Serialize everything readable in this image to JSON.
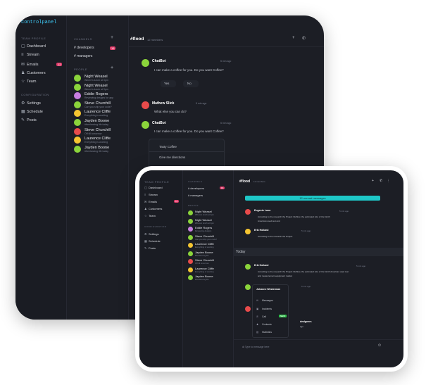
{
  "w1": {
    "logo": "controlpanel",
    "topbar": {
      "icons": [
        "◫",
        "▭"
      ]
    },
    "sidebar": {
      "section_main": "TEAM PROFILE",
      "items": [
        {
          "label": "Dashboard",
          "icon": "dashboard-icon",
          "glyph": "▢"
        },
        {
          "label": "Stream",
          "icon": "stream-icon",
          "glyph": "≡"
        },
        {
          "label": "Emails",
          "icon": "emails-icon",
          "glyph": "✉",
          "badge": "12"
        },
        {
          "label": "Customers",
          "icon": "customers-icon",
          "glyph": "♟"
        },
        {
          "label": "Team",
          "icon": "team-icon",
          "glyph": "☆"
        }
      ],
      "section_config": "CONFIGURATION",
      "config_items": [
        {
          "label": "Settings",
          "icon": "settings-icon",
          "glyph": "⚙"
        },
        {
          "label": "Schedule",
          "icon": "schedule-icon",
          "glyph": "▦"
        },
        {
          "label": "Posts",
          "icon": "posts-icon",
          "glyph": "✎"
        }
      ]
    },
    "channels": {
      "section": "CHANNELS",
      "items": [
        {
          "label": "# developers",
          "badge": "16"
        },
        {
          "label": "# managers"
        }
      ],
      "people_section": "PEOPLE",
      "people": [
        {
          "name": "Night Weasel",
          "status": "Where's lunch at 3pm",
          "color": "g"
        },
        {
          "name": "Night Weasel",
          "status": "Where's lunch at 3pm",
          "color": "g"
        },
        {
          "name": "Eddie Rogers",
          "status": "Reviewing designs for app",
          "color": "p"
        },
        {
          "name": "Steve Churchill",
          "status": "Can you ship your code?",
          "color": "g"
        },
        {
          "name": "Laurence Cliffe",
          "status": "Everything is working",
          "color": "y"
        },
        {
          "name": "Jayden Boone",
          "status": "#freelancing life today",
          "color": "g"
        },
        {
          "name": "Steve Churchill",
          "status": "Off till tomorrow",
          "color": "r"
        },
        {
          "name": "Laurence Cliffe",
          "status": "Everything is working",
          "color": "y"
        },
        {
          "name": "Jayden Boone",
          "status": "#freelancing life today",
          "color": "g"
        }
      ]
    },
    "chat": {
      "channel": "#flood",
      "members": "12 members",
      "messages": [
        {
          "name": "ChatBot",
          "time": "5 min ago",
          "text": "I can make a coffee for you. Do you want Coffee?"
        },
        {
          "name": "Mathew Slick",
          "time": "5 min ago",
          "text": "What else you can do?"
        },
        {
          "name": "ChatBot",
          "time": "5 min ago",
          "text": "I can make a coffee for you. Do you want Coffee?"
        }
      ],
      "reply_yes": "Yes",
      "reply_no": "No",
      "options": [
        "Tasty Coffee",
        "Give me directions",
        "Show movies are today"
      ]
    }
  },
  "w2": {
    "sidebar": {
      "section_main": "TEAM PROFILE",
      "items": [
        "Dashboard",
        "Stream",
        "Emails",
        "Customers",
        "Team"
      ],
      "badge": "12",
      "section_config": "CONFIGURATION",
      "config_items": [
        "Settings",
        "Schedule",
        "Posts"
      ]
    },
    "channels": {
      "section": "CHANNELS",
      "items": [
        "# developers",
        "# managers"
      ],
      "badge": "16",
      "people_section": "PEOPLE",
      "people": [
        {
          "name": "Night Weasel",
          "status": "Where's lunch at 3pm",
          "color": "g"
        },
        {
          "name": "Night Weasel",
          "status": "Where's lunch at 3pm",
          "color": "g"
        },
        {
          "name": "Eddie Rogers",
          "status": "Reviewing designs",
          "color": "p"
        },
        {
          "name": "Steve Churchill",
          "status": "Can you ship your code?",
          "color": "g"
        },
        {
          "name": "Laurence Cliffe",
          "status": "Everything is working",
          "color": "y"
        },
        {
          "name": "Jayden Boone",
          "status": "#freelancing life",
          "color": "g"
        },
        {
          "name": "Steve Churchill",
          "status": "Off till tomorrow",
          "color": "r"
        },
        {
          "name": "Laurence Cliffe",
          "status": "Everything is working",
          "color": "y"
        },
        {
          "name": "Jayden Boone",
          "status": "#freelancing life",
          "color": "g"
        }
      ]
    },
    "chat": {
      "channel": "#flood",
      "members": "12 members",
      "banner": "12 unread messages",
      "today": "Today",
      "messages": [
        {
          "name": "Eugenio Luna",
          "time": "5 min ago",
          "text": "According to the research the Project Outflow, the estimated size of the North",
          "text2": "American used test and"
        },
        {
          "name": "Erik Holland",
          "time": "5 min ago",
          "text": "According to the research the Project"
        },
        {
          "name": "Erik Holland",
          "time": "5 min ago",
          "text": "According to the research the Project Outflow, the estimated size of the North American used test",
          "text2": "and measurement equipment market"
        },
        {
          "name": "Johanne Westerman",
          "time": "5 min ago",
          "text": ""
        }
      ],
      "context": {
        "title": "Johanne Westerman",
        "items": [
          "Messages",
          "Incidents",
          "Call",
          "Contacts",
          "Statistics"
        ],
        "tag": "NEW"
      },
      "designers_label": "designers",
      "designers_sub": "ago",
      "input_placeholder": "Type to message here",
      "header_buttons": [
        "+",
        "✆",
        "⋮"
      ]
    }
  }
}
